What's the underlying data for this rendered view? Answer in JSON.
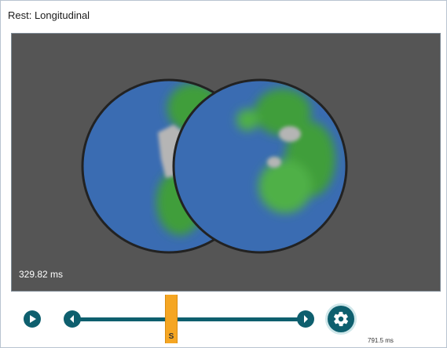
{
  "window": {
    "title": "Rest: Longitudinal"
  },
  "viewport": {
    "timestamp": "329.82 ms",
    "colors": {
      "background": "#555555",
      "map_base": "#3a6cb2",
      "map_green": "#3f9e3a",
      "map_gray": "#b5b5b5",
      "outline": "#222222"
    }
  },
  "playback": {
    "marker_label": "S",
    "duration": "791.5 ms",
    "position_fraction": 0.42,
    "icons": {
      "play": "play-icon",
      "previous": "chevron-left-icon",
      "next": "chevron-right-icon",
      "settings": "gear-icon"
    },
    "colors": {
      "accent": "#0e5f6e",
      "marker": "#f5a623"
    }
  }
}
